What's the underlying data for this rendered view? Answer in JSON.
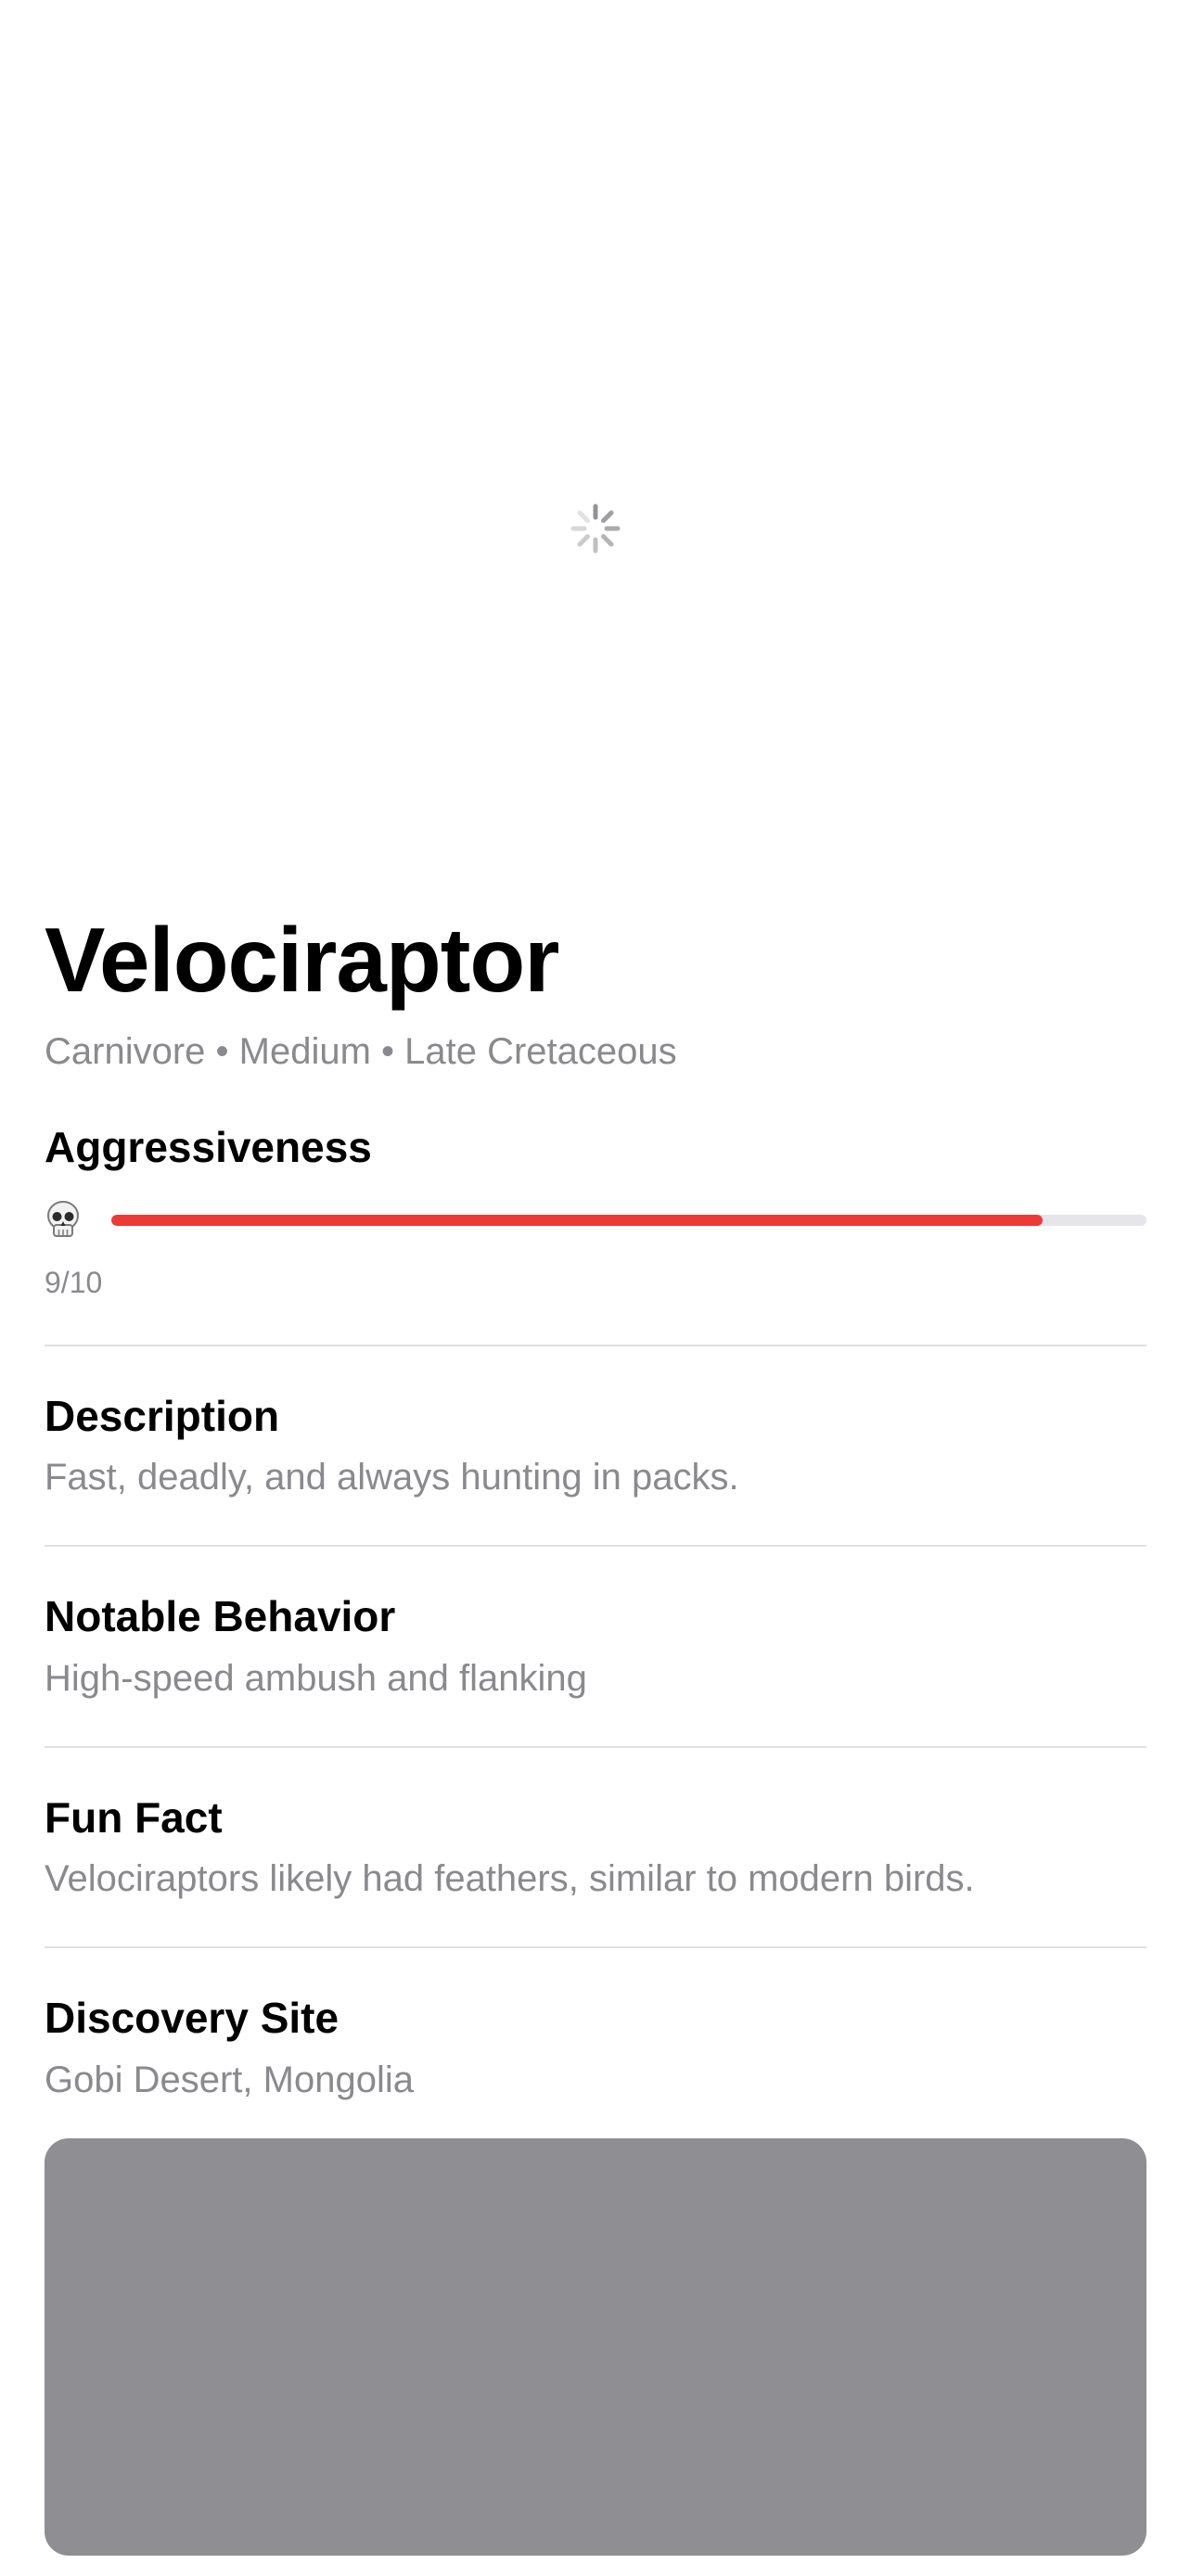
{
  "hero": {
    "loading": true,
    "spinner_icon": "activity-spinner-icon"
  },
  "dino": {
    "name": "Velociraptor",
    "meta": "Carnivore • Medium • Late Cretaceous"
  },
  "aggressiveness": {
    "label": "Aggressiveness",
    "icon": "skull-icon",
    "value": 9,
    "max": 10,
    "score_text": "9/10",
    "bar_color": "#ee3a35",
    "track_color": "#e5e5ea"
  },
  "sections": [
    {
      "title": "Description",
      "value": "Fast, deadly, and always hunting in packs."
    },
    {
      "title": "Notable Behavior",
      "value": "High-speed ambush and flanking"
    },
    {
      "title": "Fun Fact",
      "value": "Velociraptors likely had feathers, similar to modern birds."
    },
    {
      "title": "Discovery Site",
      "value": "Gobi Desert, Mongolia"
    }
  ],
  "map": {
    "color": "#8e8e93"
  }
}
